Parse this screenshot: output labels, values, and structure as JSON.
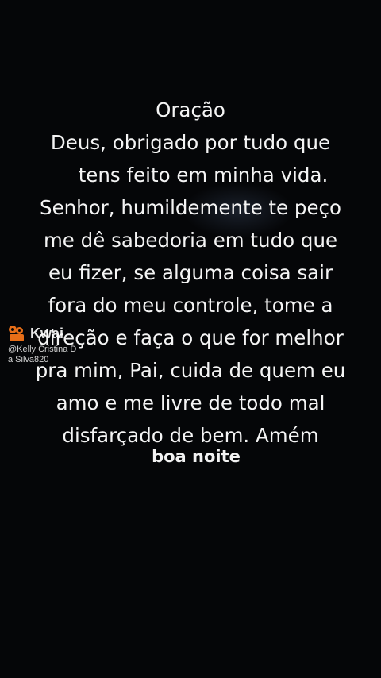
{
  "prayer": {
    "title": "Oração",
    "lines": [
      "Deus, obrigado por tudo que",
      "tens feito em minha vida.",
      "Senhor, humildemente te peço",
      "me dê sabedoria em tudo que",
      "eu fizer, se alguma coisa sair",
      "fora do meu controle, tome a",
      "direção e faça o que for melhor",
      "pra mim, Pai, cuida de quem eu",
      "amo e me livre de todo mal",
      "disfarçado de bem. Amém"
    ]
  },
  "greeting": "boa noite",
  "watermark": {
    "brand": "Kwai",
    "handle_line1": "@Kelly Cristina D",
    "handle_line2": "a Silva820",
    "logo_icon": "kwai-logo-icon",
    "logo_color": "#ff7a1a"
  },
  "colors": {
    "background": "#050608",
    "text": "#f4f4f4"
  }
}
